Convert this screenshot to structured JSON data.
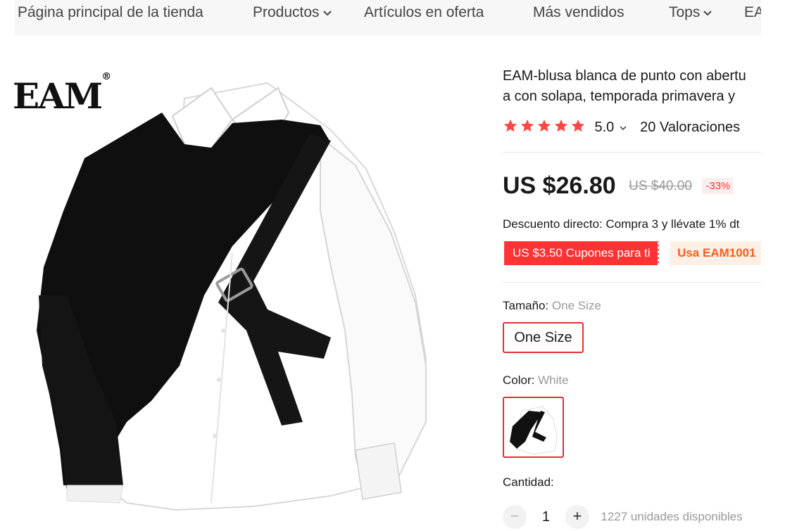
{
  "nav": {
    "items": [
      {
        "label": "Página principal de la tienda",
        "dropdown": false
      },
      {
        "label": "Productos",
        "dropdown": true
      },
      {
        "label": "Artículos en oferta",
        "dropdown": false
      },
      {
        "label": "Más vendidos",
        "dropdown": false
      },
      {
        "label": "Tops",
        "dropdown": true
      },
      {
        "label": "EA",
        "dropdown": false
      }
    ]
  },
  "brand": {
    "name": "EAM",
    "mark": "®"
  },
  "product": {
    "title_line1": "EAM-blusa blanca de punto con abertu",
    "title_line2": "a con solapa, temporada primavera y",
    "rating": {
      "stars": 5,
      "value": "5.0",
      "reviews": "20 Valoraciones",
      "star_color": "#ff4747"
    },
    "price": "US $26.80",
    "original_price": "US $40.00",
    "discount": "-33%",
    "direct_discount": "Descuento directo: Compra 3 y llévate 1% dt",
    "coupon_label": "US $3.50 Cupones para ti",
    "coupon_code": "Usa EAM1001",
    "size": {
      "label": "Tamaño:",
      "value": "One Size",
      "option": "One Size"
    },
    "color": {
      "label": "Color:",
      "value": "White"
    },
    "quantity": {
      "label": "Cantidad:",
      "value": "1",
      "minus": "−",
      "plus": "+",
      "stock": "1227 unidades disponibles"
    }
  },
  "colors": {
    "accent": "#e0312f",
    "coupon": "#ff3334",
    "code_text": "#fd5c1c"
  }
}
